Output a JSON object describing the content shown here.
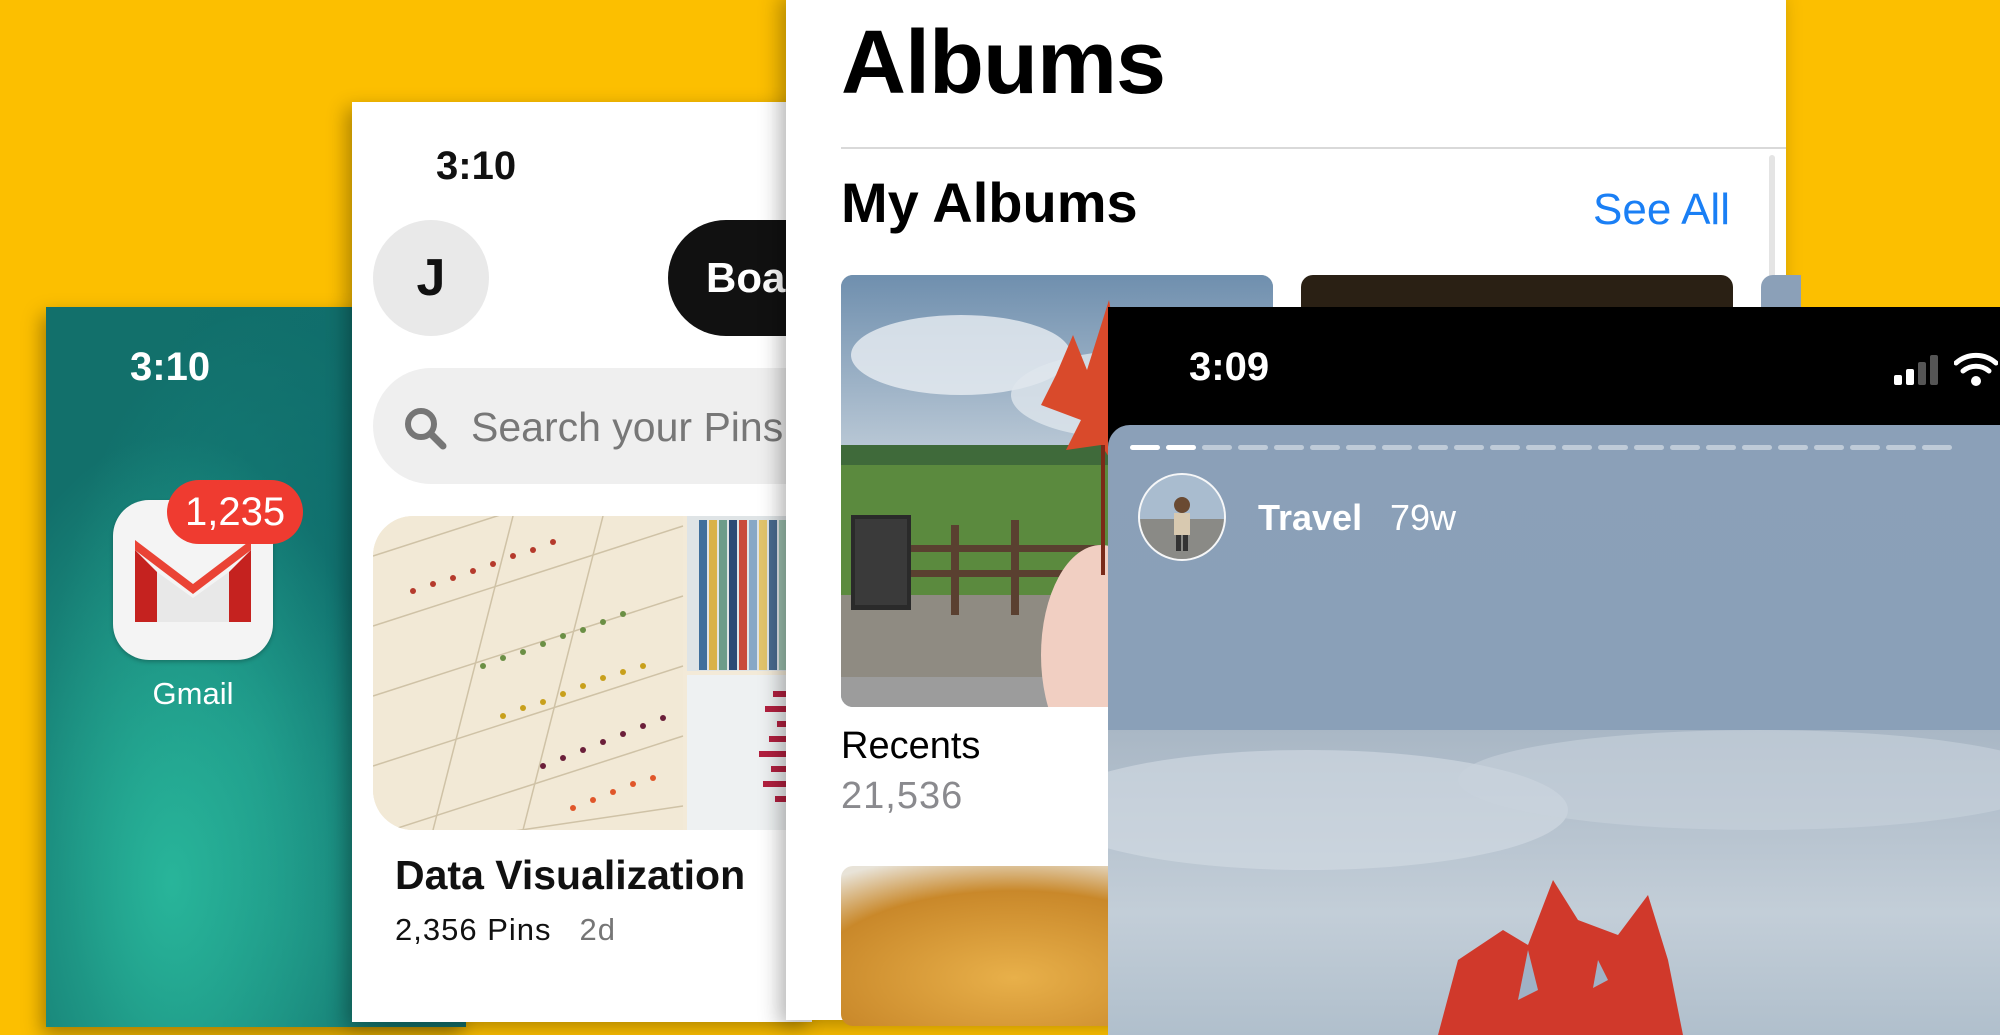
{
  "home_screen": {
    "time": "3:10",
    "gmail": {
      "label": "Gmail",
      "badge": "1,235"
    }
  },
  "pinterest": {
    "time": "3:10",
    "avatar_initial": "J",
    "tab_label": "Boa",
    "search_placeholder": "Search your Pins",
    "board": {
      "title": "Data Visualization",
      "pins": "2,356 Pins",
      "age": "2d"
    }
  },
  "photos": {
    "title": "Albums",
    "section_heading": "My Albums",
    "see_all_label": "See All",
    "album": {
      "name": "Recents",
      "count": "21,536"
    }
  },
  "story_viewer": {
    "time": "3:09",
    "username": "Travel",
    "age": "79w",
    "segments_total": 23,
    "segments_viewed": 2
  },
  "colors": {
    "background": "#FCBF00",
    "gmail_badge": "#EF3B30",
    "link_blue": "#1A7FF5"
  }
}
